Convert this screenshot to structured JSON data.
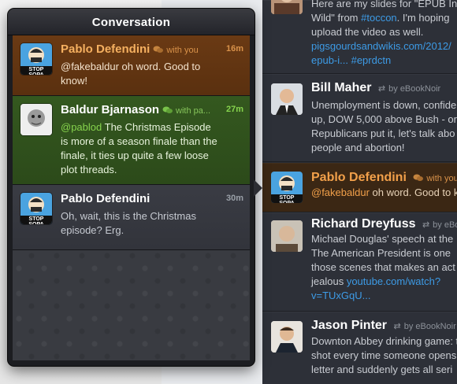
{
  "popover": {
    "title": "Conversation",
    "items": [
      {
        "name": "Pablo Defendini",
        "with": "with you",
        "time": "16m",
        "mention": "@fakebaldur",
        "text": " oh word. Good to know!",
        "avatar_label": "STOP SOPA"
      },
      {
        "name": "Baldur Bjarnason",
        "with": "with pa...",
        "time": "27m",
        "mention": "@pablod",
        "text": " The Christmas Episode is more of a season finale than the finale, it ties up quite a few loose plot threads."
      },
      {
        "name": "Pablo Defendini",
        "with": "",
        "time": "30m",
        "mention": "",
        "text": "Oh, wait, this is the Christmas episode? Erg.",
        "avatar_label": "STOP SOPA"
      }
    ]
  },
  "timeline": {
    "items": [
      {
        "name": "",
        "via": "",
        "lines": [
          "Here are my slides for \"EPUB In",
          "Wild\" from ",
          "upload the video as well.",
          "pigsgourdsandwikis.com/2012/",
          "epub-i...  "
        ],
        "hashtag1": "#toccon",
        "line2_rest": ". I'm hoping",
        "hashtag2": "#eprdctn"
      },
      {
        "name": "Bill Maher",
        "via": "by eBookNoir",
        "lines": [
          "Unemployment is down, confide",
          "up, DOW 5,000 above Bush - or",
          "Republicans put it, let's talk abo",
          "people and abortion!"
        ]
      },
      {
        "name": "Pablo Defendini",
        "via": "with you",
        "mention": "@fakebaldur",
        "text": " oh word. Good to k",
        "avatar_label": "STOP SOPA"
      },
      {
        "name": "Richard Dreyfuss",
        "via": "by eBookNoir",
        "lines": [
          "Michael Douglas' speech at the",
          "The American President is one",
          "those scenes that makes an act",
          "jealous "
        ],
        "link1": "youtube.com/watch?",
        "link2": "v=TUxGqU..."
      },
      {
        "name": "Jason Pinter",
        "via": "by eBookNoir",
        "lines": [
          "Downton Abbey drinking game: t",
          "shot every time someone opens",
          "letter and suddenly gets all seri"
        ]
      }
    ]
  },
  "colors": {
    "orange": "#f2a04a",
    "green": "#86d34d",
    "link": "#3d9be6"
  }
}
